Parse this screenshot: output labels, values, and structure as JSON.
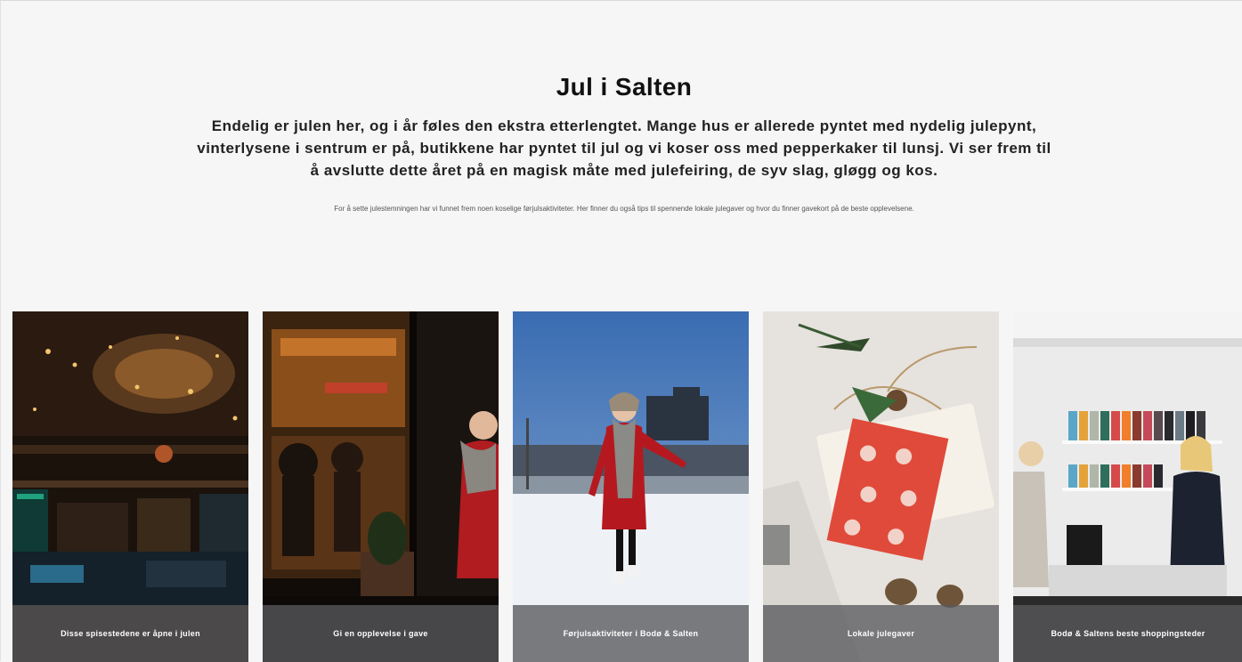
{
  "page": {
    "title": "Jul i Salten",
    "lead": "Endelig er julen her, og i år føles den ekstra etterlengtet. Mange hus er allerede pyntet med nydelig julepynt, vinterlysene i sentrum er på, butikkene har pyntet til jul og vi koser oss med pepperkaker til lunsj. Vi ser frem til å avslutte dette året på en magisk måte med julefeiring, de syv slag, gløgg og kos.",
    "small": "For å sette julestemningen har vi funnet frem noen koselige førjulsaktiviteter. Her finner du også tips til spennende lokale julegaver og hvor du finner gavekort på de beste opplevelsene."
  },
  "cards": [
    {
      "caption": "Disse spisestedene er åpne i julen",
      "image": "restaurant-interior-image"
    },
    {
      "caption": "Gi en opplevelse i gave",
      "image": "woman-outside-cafe-image"
    },
    {
      "caption": "Førjulsaktiviteter i Bodø & Salten",
      "image": "ice-skating-image"
    },
    {
      "caption": "Lokale julegaver",
      "image": "gift-wrapping-image"
    },
    {
      "caption": "Bodø & Saltens beste shoppingsteder",
      "image": "shop-counter-image"
    }
  ],
  "colors": {
    "background": "#f6f6f6",
    "caption_overlay": "#58585c",
    "gift_red": "#e04a3a",
    "sky_blue": "#3f6fb0"
  }
}
